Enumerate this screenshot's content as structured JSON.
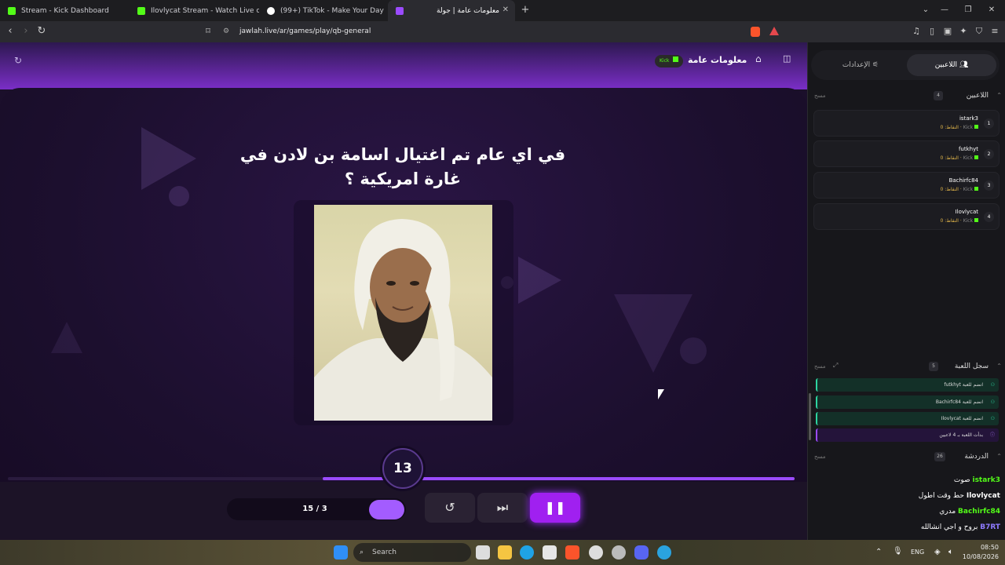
{
  "browser": {
    "tabs": [
      {
        "title": "Stream - Kick Dashboard",
        "favicon_color": "#53fc18"
      },
      {
        "title": "Ilovlycat Stream - Watch Live on Kick",
        "favicon_color": "#53fc18"
      },
      {
        "title": "(99+) TikTok - Make Your Day",
        "favicon_color": "#ffffff"
      },
      {
        "title": "معلومات عامة | جولة",
        "favicon_color": "#9b4bff"
      }
    ],
    "url": "jawlah.live/ar/games/play/qb-general"
  },
  "game": {
    "header_title": "معلومات عامة",
    "platform_badge": "Kick",
    "question": "في اي عام تم اغتيال اسامة بن لادن في غارة امريكية ؟",
    "timer": "13",
    "timer_progress": 0.6,
    "counter": "15 / 3"
  },
  "panel": {
    "tab_players": "اللاعبين",
    "tab_settings": "الإعدادات",
    "players_section": {
      "title": "اللاعبين",
      "count": "4",
      "clear": "مسح"
    },
    "players": [
      {
        "rank": "1",
        "name": "istark3",
        "platform": "Kick",
        "points": "النقاط: 0"
      },
      {
        "rank": "2",
        "name": "futkhyt",
        "platform": "Kick",
        "points": "النقاط: 0"
      },
      {
        "rank": "3",
        "name": "Bachirfc84",
        "platform": "Kick",
        "points": "النقاط: 0"
      },
      {
        "rank": "4",
        "name": "Ilovlycat",
        "platform": "Kick",
        "points": "النقاط: 0"
      }
    ],
    "log_section": {
      "title": "سجل اللعبة",
      "count": "5",
      "clear": "مسح"
    },
    "log": [
      {
        "text": "futkhyt انضم للعبة"
      },
      {
        "text": "Bachirfc84 انضم للعبة"
      },
      {
        "text": "Ilovlycat انضم للعبة"
      },
      {
        "text": "بدأت اللعبة بـ 4 لاعبين"
      }
    ],
    "chat_section": {
      "title": "الدردشة",
      "count": "26",
      "clear": "مسح"
    },
    "chat": [
      {
        "user": "istark3",
        "msg": "صوت",
        "color": "#53fc18"
      },
      {
        "user": "Ilovlycat",
        "msg": "حط وقت اطول",
        "color": "#ffffff"
      },
      {
        "user": "Bachirfc84",
        "msg": "مدري",
        "color": "#53fc18"
      },
      {
        "user": "B7RT",
        "msg": "بروح و اجي انشالله",
        "color": "#8f7bff"
      }
    ]
  },
  "taskbar": {
    "search_placeholder": "Search",
    "lang": "ENG",
    "time": "08:50",
    "date": "10/08/2026"
  }
}
